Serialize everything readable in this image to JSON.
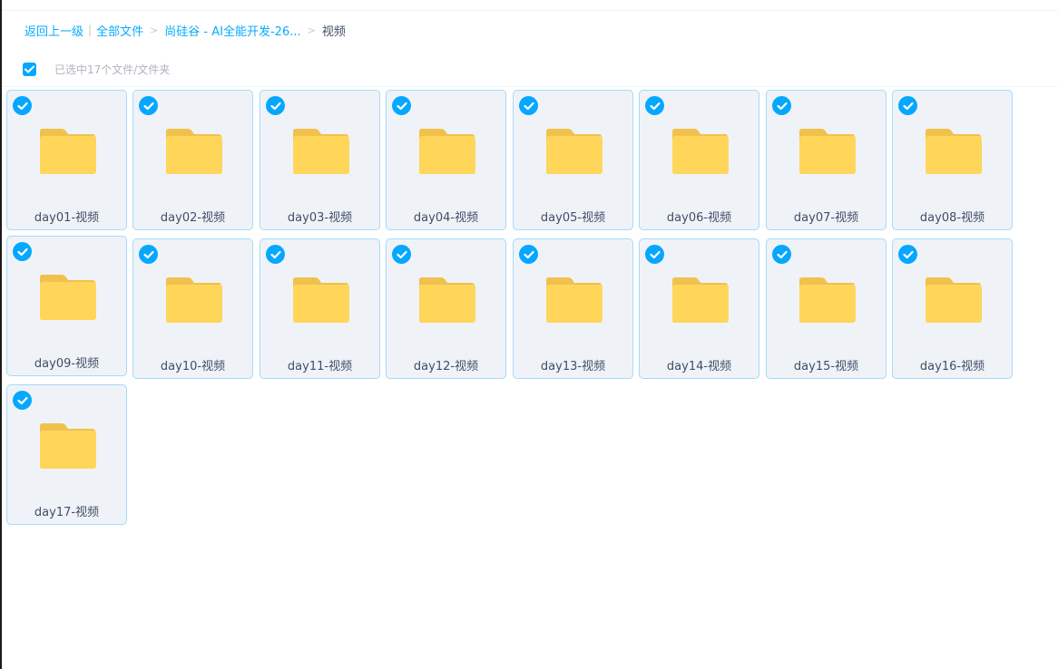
{
  "breadcrumb": {
    "back_label": "返回上一级",
    "items": [
      "全部文件",
      "尚硅谷 - AI全能开发-26...",
      "视频"
    ]
  },
  "selection": {
    "count_label": "已选中17个文件/文件夹"
  },
  "icons": {
    "checkbox": "check-icon",
    "folder": "folder-icon"
  },
  "colors": {
    "accent": "#06a7ff",
    "folder": "#ffd659",
    "card_bg": "#eff3f8",
    "card_border": "#a4dafa"
  },
  "files": [
    {
      "name": "day01-视频",
      "selected": true
    },
    {
      "name": "day02-视频",
      "selected": true
    },
    {
      "name": "day03-视频",
      "selected": true
    },
    {
      "name": "day04-视频",
      "selected": true
    },
    {
      "name": "day05-视频",
      "selected": true
    },
    {
      "name": "day06-视频",
      "selected": true
    },
    {
      "name": "day07-视频",
      "selected": true
    },
    {
      "name": "day08-视频",
      "selected": true
    },
    {
      "name": "day09-视频",
      "selected": true
    },
    {
      "name": "day10-视频",
      "selected": true
    },
    {
      "name": "day11-视频",
      "selected": true
    },
    {
      "name": "day12-视频",
      "selected": true
    },
    {
      "name": "day13-视频",
      "selected": true
    },
    {
      "name": "day14-视频",
      "selected": true
    },
    {
      "name": "day15-视频",
      "selected": true
    },
    {
      "name": "day16-视频",
      "selected": true
    },
    {
      "name": "day17-视频",
      "selected": true
    }
  ]
}
